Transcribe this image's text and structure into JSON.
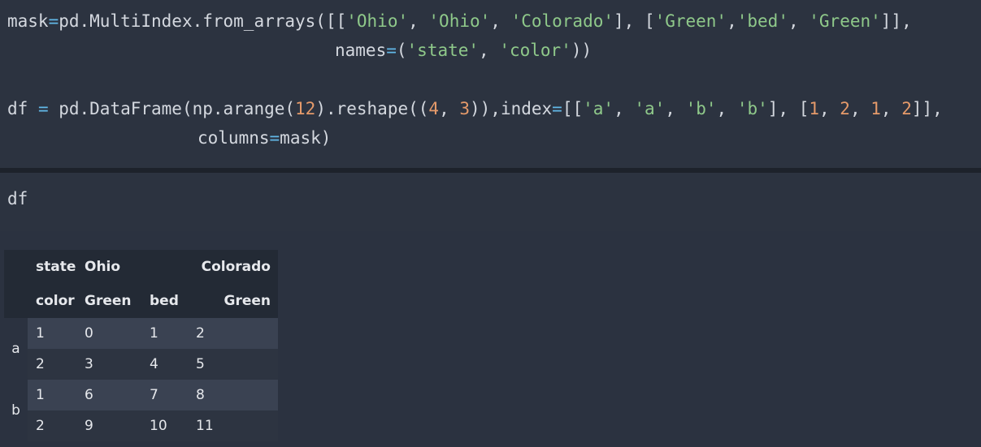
{
  "cell1": {
    "line1": {
      "a": "mask",
      "eq": "=",
      "b": "pd.MultiIndex.from_arrays([[",
      "s1": "'Ohio'",
      "c1": ", ",
      "s2": "'Ohio'",
      "c2": ", ",
      "s3": "'Colorado'",
      "c3": "], [",
      "s4": "'Green'",
      "c4": ",",
      "s5": "'bed'",
      "c5": ", ",
      "s6": "'Green'",
      "c6": "]],"
    },
    "line2": {
      "a": "names",
      "eq": "=",
      "b": "(",
      "s1": "'state'",
      "c1": ", ",
      "s2": "'color'",
      "c2": "))"
    },
    "line3": {
      "a": "df ",
      "eq": "=",
      "b": " pd.DataFrame(np.arange(",
      "n1": "12",
      "b2": ").reshape((",
      "n2": "4",
      "b3": ", ",
      "n3": "3",
      "b4": ")),index",
      "eq2": "=",
      "b5": "[[",
      "s1": "'a'",
      "c1": ", ",
      "s2": "'a'",
      "c2": ", ",
      "s3": "'b'",
      "c3": ", ",
      "s4": "'b'",
      "c4": "], [",
      "n4": "1",
      "c5": ", ",
      "n5": "2",
      "c6": ", ",
      "n6": "1",
      "c7": ", ",
      "n7": "2",
      "c8": "]],"
    },
    "line4": {
      "a": "columns",
      "eq": "=",
      "b": "mask)"
    }
  },
  "cell2": {
    "code": "df"
  },
  "dataframe": {
    "header_row1": {
      "name": "state",
      "ohio": "Ohio",
      "colorado": "Colorado"
    },
    "header_row2": {
      "name": "color",
      "c1": "Green",
      "c2": "bed",
      "c3": "Green"
    },
    "rows": [
      {
        "idx0": "a",
        "idx1": "1",
        "v": [
          "0",
          "1",
          "2"
        ]
      },
      {
        "idx0": "",
        "idx1": "2",
        "v": [
          "3",
          "4",
          "5"
        ]
      },
      {
        "idx0": "b",
        "idx1": "1",
        "v": [
          "6",
          "7",
          "8"
        ]
      },
      {
        "idx0": "",
        "idx1": "2",
        "v": [
          "9",
          "10",
          "11"
        ]
      }
    ]
  }
}
